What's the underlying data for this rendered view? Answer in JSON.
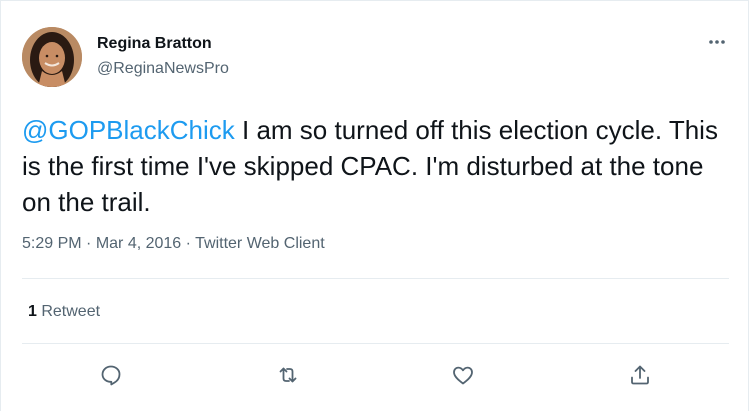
{
  "tweet": {
    "author": {
      "display_name": "Regina Bratton",
      "handle": "@ReginaNewsPro"
    },
    "text": {
      "mention": "@GOPBlackChick",
      "body": " I am so turned off this election cycle. This is the first time I've skipped CPAC. I'm disturbed at the tone on the trail."
    },
    "meta": {
      "time": "5:29 PM",
      "separator": " · ",
      "date": "Mar 4, 2016",
      "source": "Twitter Web Client"
    },
    "stats": {
      "retweet_count": "1",
      "retweet_label": " Retweet"
    },
    "icons": {
      "more": "more-horizontal-icon",
      "reply": "reply-icon",
      "retweet": "retweet-icon",
      "like": "heart-icon",
      "share": "share-icon"
    },
    "colors": {
      "link": "#1d9bf0",
      "secondary_text": "#536471",
      "primary_text": "#0f1419",
      "divider": "#e6ecf0"
    }
  }
}
